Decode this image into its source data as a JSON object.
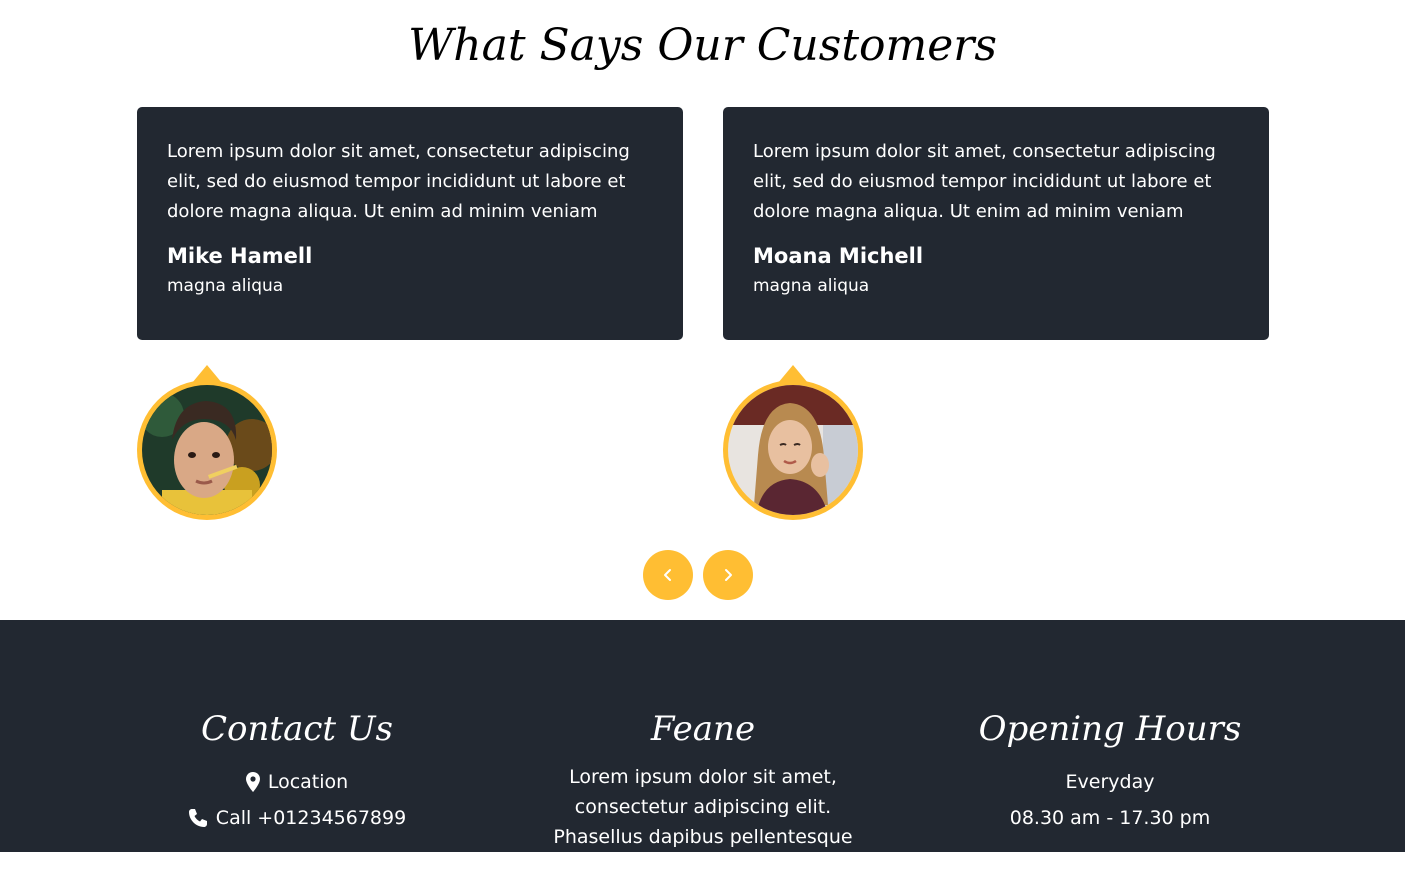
{
  "testimonials": {
    "title": "What Says Our Customers",
    "items": [
      {
        "quote": "Lorem ipsum dolor sit amet, consectetur adipiscing elit, sed do eiusmod tempor incididunt ut labore et dolore magna aliqua. Ut enim ad minim veniam",
        "name": "Mike Hamell",
        "role": "magna aliqua"
      },
      {
        "quote": "Lorem ipsum dolor sit amet, consectetur adipiscing elit, sed do eiusmod tempor incididunt ut labore et dolore magna aliqua. Ut enim ad minim veniam",
        "name": "Moana Michell",
        "role": "magna aliqua"
      }
    ],
    "prev_icon": "chevron-left-icon",
    "next_icon": "chevron-right-icon"
  },
  "footer": {
    "contact": {
      "title": "Contact Us",
      "location": "Location",
      "phone": "Call +01234567899"
    },
    "about": {
      "title": "Feane",
      "text": "Lorem ipsum dolor sit amet, consectetur adipiscing elit. Phasellus dapibus pellentesque lorem, id"
    },
    "hours": {
      "title": "Opening Hours",
      "days": "Everyday",
      "time": "08.30 am - 17.30 pm"
    }
  },
  "colors": {
    "accent": "#ffbe33",
    "dark": "#222831",
    "white": "#ffffff"
  }
}
